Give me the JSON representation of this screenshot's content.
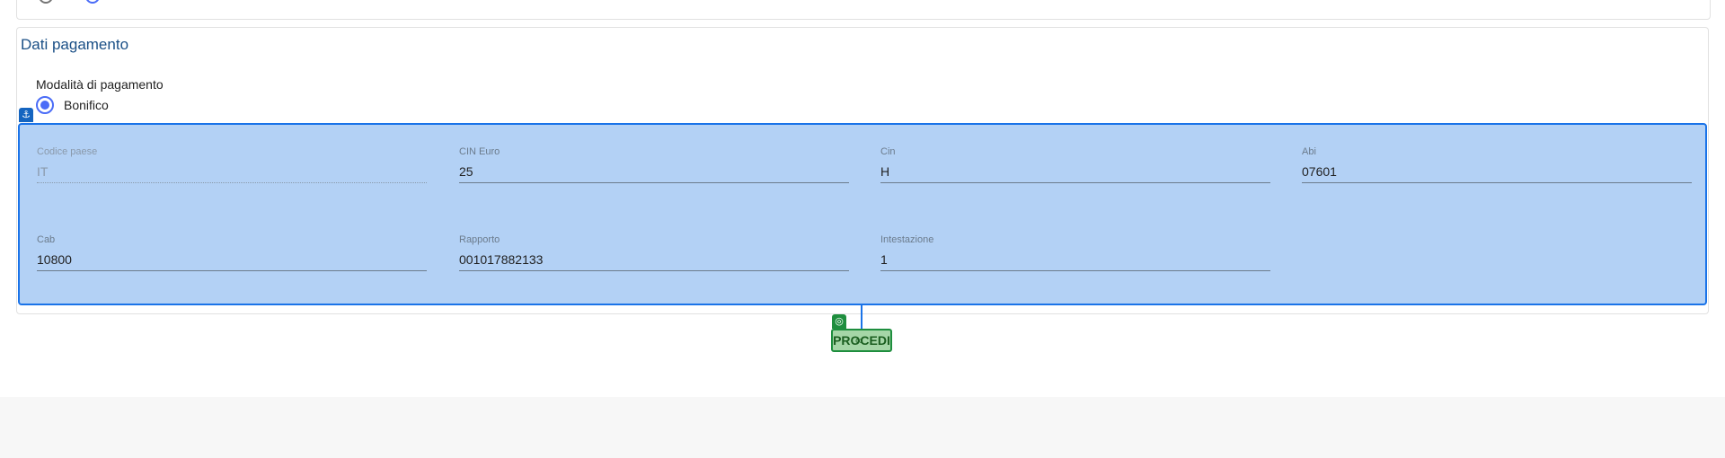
{
  "section": {
    "title": "Dati pagamento"
  },
  "payment_method": {
    "label": "Modalità di pagamento",
    "options": [
      {
        "label": "Bonifico",
        "selected": true
      }
    ]
  },
  "fields": {
    "codice_paese": {
      "label": "Codice paese",
      "value": "IT",
      "disabled": true
    },
    "cin_euro": {
      "label": "CIN Euro",
      "value": "25"
    },
    "cin": {
      "label": "Cin",
      "value": "H"
    },
    "abi": {
      "label": "Abi",
      "value": "07601"
    },
    "cab": {
      "label": "Cab",
      "value": "10800"
    },
    "rapporto": {
      "label": "Rapporto",
      "value": "001017882133"
    },
    "intestazione": {
      "label": "Intestazione",
      "value": "1"
    }
  },
  "actions": {
    "proceed_label": "PROCEDI"
  },
  "icons": {
    "anchor": "anchor-icon",
    "target": "target-icon",
    "link": "link-icon"
  },
  "colors": {
    "accent": "#4a6cf7",
    "section_title": "#1a4f86",
    "overlay_fill": "#b3d1f5",
    "overlay_border": "#1a73e8",
    "proceed_fill": "#a5d6a7",
    "proceed_border": "#1e8e3e"
  }
}
